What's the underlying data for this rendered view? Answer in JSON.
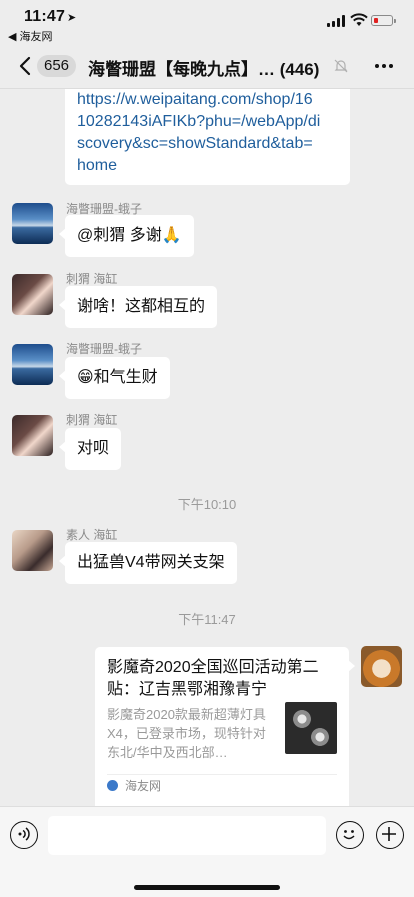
{
  "status_bar": {
    "time": "11:47",
    "location_arrow": "➤",
    "back_app": "◀ 海友网"
  },
  "nav": {
    "unread_count": "656",
    "title": "海瞥珊盟【每晚九点】… (446)",
    "icons": [
      "back-chevron-icon",
      "mute-bell-icon",
      "more-dots-icon"
    ]
  },
  "messages": [
    {
      "type": "link",
      "sender": "",
      "text": "https://w.weipaitang.com/shop/1610282143iAFIKb?phu=/webApp/discovery&sc=showStandard&tab=home",
      "lines": [
        "https://w.weipaitang.com/shop/16",
        "10282143iAFIKb?phu=/webApp/di",
        "scovery&sc=showStandard&tab=",
        "home"
      ]
    },
    {
      "sender": "海瞥珊盟-蛾子",
      "text": "@刺猬 多谢🙏"
    },
    {
      "sender": "刺猬 海缸",
      "text": "谢啥！这都相互的"
    },
    {
      "sender": "海瞥珊盟-蛾子",
      "text": "😁和气生财"
    },
    {
      "sender": "刺猬 海缸",
      "text": "对呗"
    },
    {
      "type": "time",
      "text": "下午10:10"
    },
    {
      "sender": "素人 海缸",
      "text": "出猛兽V4带网关支架"
    },
    {
      "type": "time",
      "text": "下午11:47"
    },
    {
      "type": "card",
      "title": "影魔奇2020全国巡回活动第二贴：辽吉黑鄂湘豫青宁",
      "desc": "影魔奇2020款最新超薄灯具X4，已登录市场，现特针对东北/华中及西北部…",
      "source": "海友网"
    }
  ],
  "input_bar": {
    "placeholder": "",
    "icons": [
      "voice-icon",
      "emoji-icon",
      "plus-icon"
    ]
  }
}
